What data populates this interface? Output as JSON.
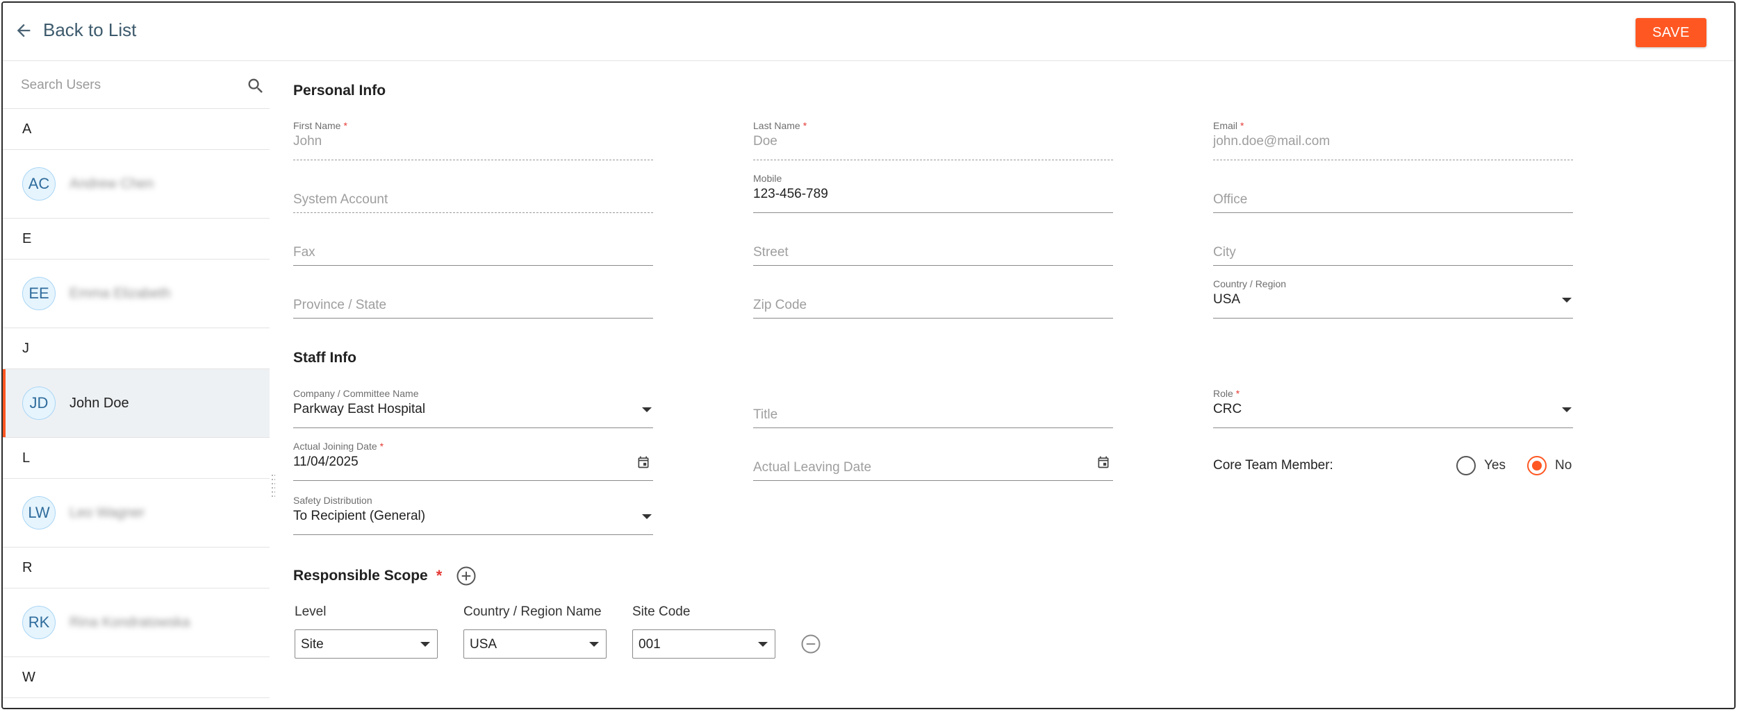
{
  "header": {
    "back_label": "Back to List",
    "save_label": "SAVE"
  },
  "sidebar": {
    "search_placeholder": "Search Users",
    "groups": [
      {
        "letter": "A",
        "initials": "AC",
        "name": "Andrew Chen",
        "blurred": true
      },
      {
        "letter": "E",
        "initials": "EE",
        "name": "Emma Elizabeth",
        "blurred": true
      },
      {
        "letter": "J",
        "initials": "JD",
        "name": "John Doe",
        "blurred": false
      },
      {
        "letter": "L",
        "initials": "LW",
        "name": "Leo Wagner",
        "blurred": true
      },
      {
        "letter": "R",
        "initials": "RK",
        "name": "Rina Kondratowska",
        "blurred": true
      },
      {
        "letter": "W"
      }
    ]
  },
  "personal": {
    "title": "Personal Info",
    "first_name": {
      "label": "First Name",
      "value": "John"
    },
    "last_name": {
      "label": "Last Name",
      "value": "Doe"
    },
    "email": {
      "label": "Email",
      "value": "john.doe@mail.com"
    },
    "system_account": {
      "placeholder": "System Account"
    },
    "mobile": {
      "label": "Mobile",
      "value": "123-456-789"
    },
    "office": {
      "placeholder": "Office"
    },
    "fax": {
      "placeholder": "Fax"
    },
    "street": {
      "placeholder": "Street"
    },
    "city": {
      "placeholder": "City"
    },
    "province": {
      "placeholder": "Province / State"
    },
    "zip": {
      "placeholder": "Zip Code"
    },
    "country": {
      "label": "Country / Region",
      "value": "USA"
    }
  },
  "staff": {
    "title": "Staff Info",
    "company": {
      "label": "Company / Committee Name",
      "value": "Parkway East Hospital"
    },
    "job_title": {
      "placeholder": "Title"
    },
    "role": {
      "label": "Role",
      "value": "CRC"
    },
    "joining": {
      "label": "Actual Joining Date",
      "value": "11/04/2025"
    },
    "leaving": {
      "placeholder": "Actual Leaving Date"
    },
    "core_team": {
      "label": "Core Team Member:",
      "yes": "Yes",
      "no": "No",
      "selected": "No"
    },
    "safety": {
      "label": "Safety Distribution",
      "value": "To Recipient (General)"
    }
  },
  "scope": {
    "title": "Responsible Scope",
    "level_label": "Level",
    "country_label": "Country / Region Name",
    "site_label": "Site Code",
    "level": "Site",
    "country": "USA",
    "site": "001"
  },
  "colors": {
    "accent": "#ff5722",
    "avatar_bg": "#e6f4fd",
    "required": "#e53935"
  }
}
